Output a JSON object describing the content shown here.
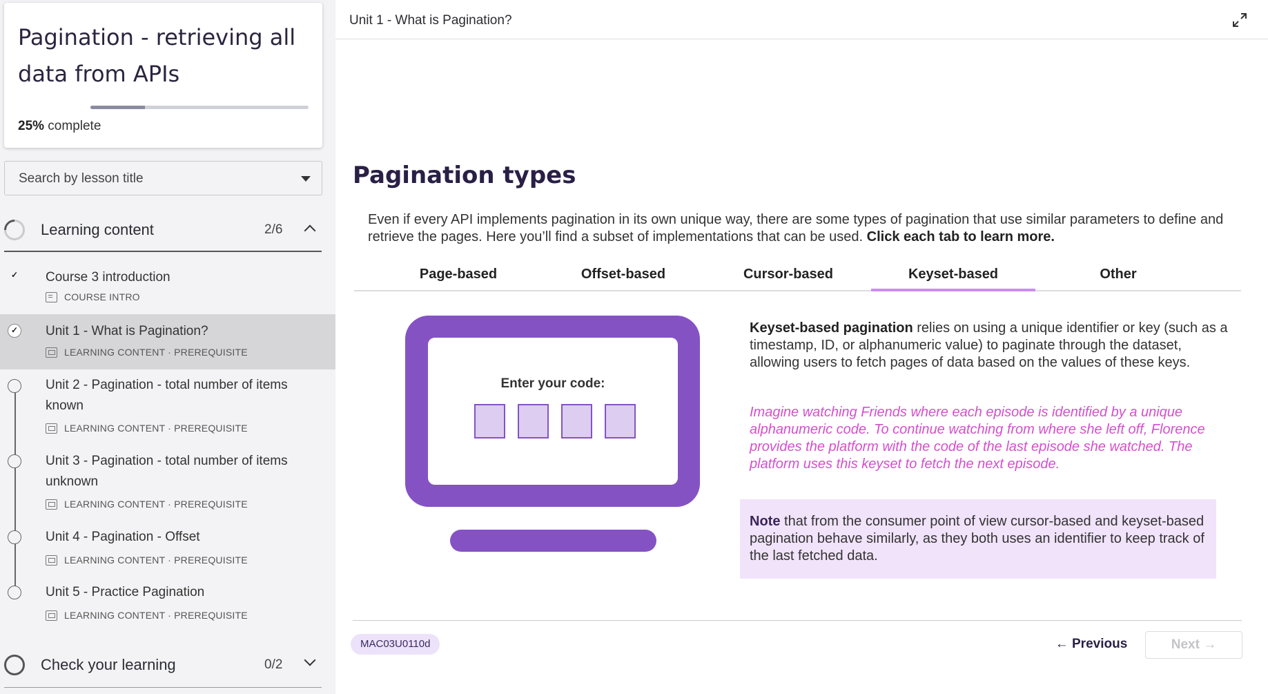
{
  "course": {
    "title": "Pagination - retrieving all data from APIs",
    "progress_percent": 25,
    "progress_value": "25%",
    "progress_suffix": " complete"
  },
  "search": {
    "placeholder": "Search by lesson title"
  },
  "sections": [
    {
      "name": "Learning content",
      "count": "2/6",
      "expanded": true
    },
    {
      "name": "Check your learning",
      "count": "0/2",
      "expanded": false
    }
  ],
  "lessons": [
    {
      "title": "Course 3 introduction",
      "meta": "COURSE INTRO",
      "status": "done"
    },
    {
      "title": "Unit 1 - What is Pagination?",
      "meta": "LEARNING CONTENT · PREREQUISITE",
      "status": "done",
      "active": true
    },
    {
      "title": "Unit 2 - Pagination - total number of items known",
      "meta": "LEARNING CONTENT · PREREQUISITE",
      "status": "todo"
    },
    {
      "title": "Unit 3 - Pagination - total number of items unknown",
      "meta": "LEARNING CONTENT · PREREQUISITE",
      "status": "todo"
    },
    {
      "title": "Unit 4 - Pagination - Offset",
      "meta": "LEARNING CONTENT · PREREQUISITE",
      "status": "todo"
    },
    {
      "title": "Unit 5 - Practice Pagination",
      "meta": "LEARNING CONTENT · PREREQUISITE",
      "status": "todo"
    }
  ],
  "checkmark": "✓",
  "header": {
    "breadcrumb": "Unit 1 - What is Pagination?"
  },
  "content": {
    "title": "Pagination types",
    "intro": "Even if every API implements pagination in its own unique way, there are some types of pagination that use similar parameters to define and retrieve the pages. Here you’ll find a subset of implementations that can be used.",
    "intro_bold": "Click each tab to learn more.",
    "tabs": [
      "Page-based",
      "Offset-based",
      "Cursor-based",
      "Keyset-based",
      "Other"
    ],
    "active_tab": "Keyset-based",
    "illustration_label": "Enter your code:",
    "desc_bold": "Keyset-based pagination",
    "desc": " relies on using a unique identifier or key (such as a timestamp, ID, or alphanumeric value) to paginate through the dataset, allowing users to fetch pages of data based on the values of these keys.",
    "example": "Imagine watching Friends where each episode is identified by a unique alphanumeric code. To continue watching from where she left off, Florence provides the platform with the code of the last episode she watched. The platform uses this keyset to fetch the next episode.",
    "note_bold": "Note",
    "note": " that from the consumer point of view cursor-based and keyset-based pagination behave similarly, as they both uses an identifier to keep track of the last fetched data."
  },
  "footer": {
    "code": "MAC03U0110d",
    "prev_label": "← Previous",
    "next_label": "Next →"
  },
  "colors": {
    "accent": "#8552c4",
    "tab_underline": "#c98df0",
    "example_text": "#d54fcd",
    "note_bg": "#f1e3fa"
  }
}
